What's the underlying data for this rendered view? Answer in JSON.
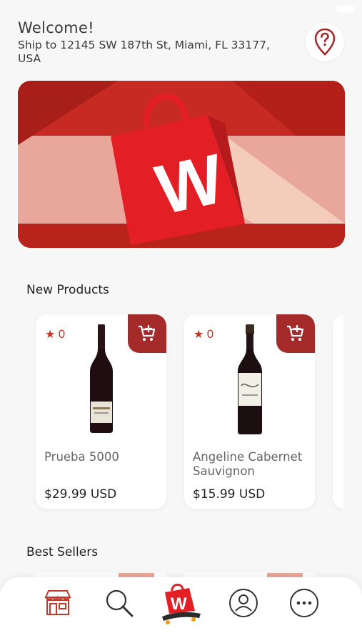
{
  "header": {
    "welcome": "Welcome!",
    "address": "Ship to 12145 SW 187th St, Miami, FL 33177, USA"
  },
  "sections": {
    "new_products": "New Products",
    "best_sellers": "Best Sellers"
  },
  "products": [
    {
      "rating": "0",
      "name": "Prueba 5000",
      "price": "$29.99 USD"
    },
    {
      "rating": "0",
      "name": "Angeline Cabernet Sauvignon",
      "price": "$15.99 USD"
    }
  ],
  "banner": {
    "logo_letter": "W"
  },
  "colors": {
    "accent": "#a52a2a",
    "brand_red": "#e31e24"
  },
  "icons": {
    "help": "location-question-icon",
    "cart": "add-to-cart-icon",
    "store": "store-icon",
    "search": "search-icon",
    "home": "w-logo-icon",
    "account": "account-icon",
    "more": "more-icon"
  }
}
